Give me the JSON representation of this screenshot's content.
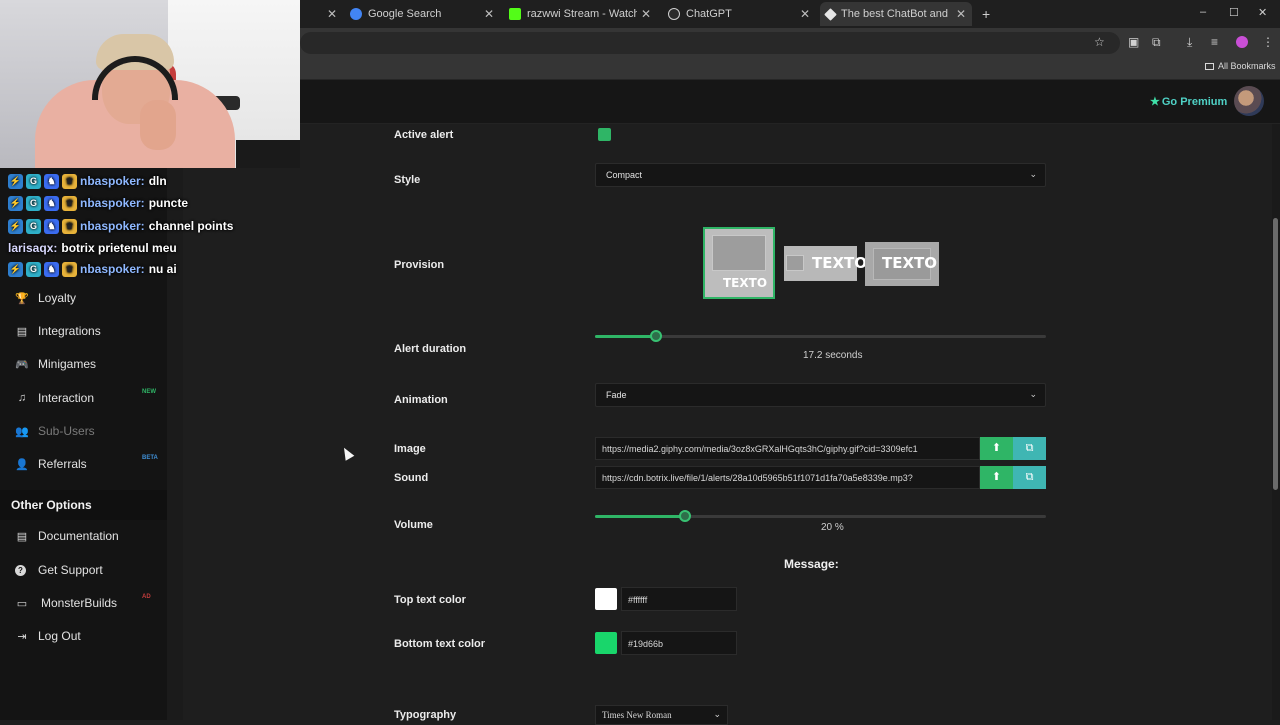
{
  "browser": {
    "tabs": [
      {
        "title": "Google Search",
        "favicon_color": "#4285f4"
      },
      {
        "title": "razwwi Stream - Watch Live on K",
        "favicon_color": "#53fc18"
      },
      {
        "title": "ChatGPT",
        "favicon_color": "#cfcfcf"
      },
      {
        "title": "The best ChatBot and Widgets f",
        "favicon_color": "#e6e6e6"
      }
    ],
    "new_tab": "+",
    "window_controls": {
      "minimize": "–",
      "maximize": "☐",
      "close": "✕"
    },
    "bookmarks_label": "All Bookmarks"
  },
  "header": {
    "premium_label": "Go Premium"
  },
  "sidebar": {
    "items": [
      {
        "label": "Loyalty",
        "icon": "trophy-icon",
        "glyph": "🏆"
      },
      {
        "label": "Integrations",
        "icon": "list-icon",
        "glyph": "▤"
      },
      {
        "label": "Minigames",
        "icon": "gamepad-icon",
        "glyph": "🎮"
      },
      {
        "label": "Interaction",
        "icon": "music-icon",
        "glyph": "♫",
        "badge": "NEW",
        "badge_color": "#2fb566"
      },
      {
        "label": "Sub-Users",
        "icon": "users-icon",
        "glyph": "👥",
        "disabled": true
      },
      {
        "label": "Referrals",
        "icon": "user-plus-icon",
        "glyph": "👤",
        "badge": "BETA",
        "badge_color": "#3f8fd6"
      }
    ],
    "other_section": "Other Options",
    "other_items": [
      {
        "label": "Documentation",
        "icon": "document-icon",
        "glyph": "▤"
      },
      {
        "label": "Get Support",
        "icon": "help-icon",
        "glyph": "?"
      },
      {
        "label": "MonsterBuilds",
        "icon": "laptop-icon",
        "glyph": "▭",
        "badge": "AD",
        "badge_color": "#c43d3d"
      },
      {
        "label": "Log Out",
        "icon": "logout-icon",
        "glyph": "⇥"
      }
    ]
  },
  "chat": [
    {
      "user": "nbaspoker:",
      "text": "dln"
    },
    {
      "user": "nbaspoker:",
      "text": "puncte"
    },
    {
      "user": "nbaspoker:",
      "text": "channel points"
    },
    {
      "user": "larisaqx:",
      "text": "botrix prietenul meu",
      "plain": true
    },
    {
      "user": "nbaspoker:",
      "text": "nu ai"
    }
  ],
  "form": {
    "active_alert_label": "Active alert",
    "style_label": "Style",
    "style_value": "Compact",
    "provision_label": "Provision",
    "provision_text": "TEXTO",
    "alert_duration_label": "Alert duration",
    "alert_duration_value": "17.2",
    "alert_duration_unit": "seconds",
    "alert_duration_fraction": 0.136,
    "animation_label": "Animation",
    "animation_value": "Fade",
    "image_label": "Image",
    "image_url": "https://media2.giphy.com/media/3oz8xGRXalHGqts3hC/giphy.gif?cid=3309efc1",
    "sound_label": "Sound",
    "sound_url": "https://cdn.botrix.live/file/1/alerts/28a10d5965b51f1071d1fa70a5e8339e.mp3?",
    "volume_label": "Volume",
    "volume_value": "20",
    "volume_unit": "%",
    "volume_fraction": 0.2,
    "message_heading": "Message:",
    "top_text_color_label": "Top text color",
    "top_text_color_value": "#ffffff",
    "bottom_text_color_label": "Bottom text color",
    "bottom_text_color_value": "#19d66b",
    "typography_label": "Typography",
    "typography_value": "Times New Roman"
  }
}
